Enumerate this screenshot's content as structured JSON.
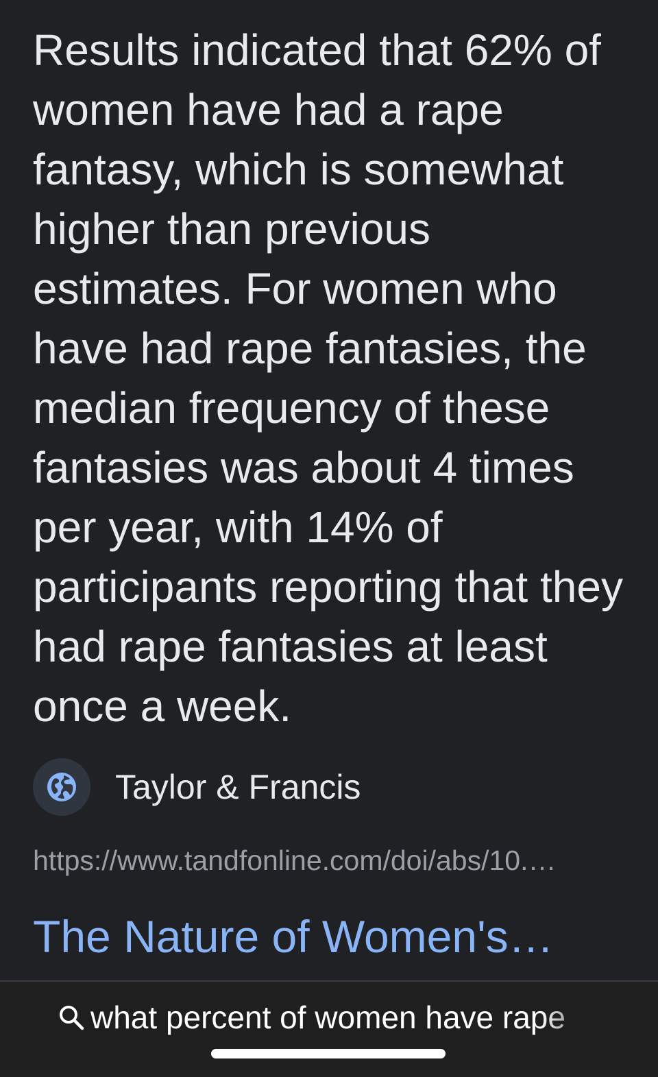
{
  "snippet": {
    "text": "Results indicated that 62% of women have had a rape fantasy, which is somewhat higher than previous estimates. For women who have had rape fantasies, the median frequency of these fantasies was about 4 times per year, with 14% of participants reporting that they had rape fantasies at least once a week."
  },
  "source": {
    "icon": "globe-icon",
    "name": "Taylor & Francis",
    "url": "https://www.tandfonline.com/doi/abs/10.…"
  },
  "result": {
    "title": "The Nature of Women's…"
  },
  "search_bar": {
    "icon": "search-icon",
    "query": "what percent of women have rape"
  },
  "colors": {
    "background": "#202124",
    "text": "#e8eaed",
    "link": "#8ab4f8",
    "url": "#9aa0a6"
  }
}
